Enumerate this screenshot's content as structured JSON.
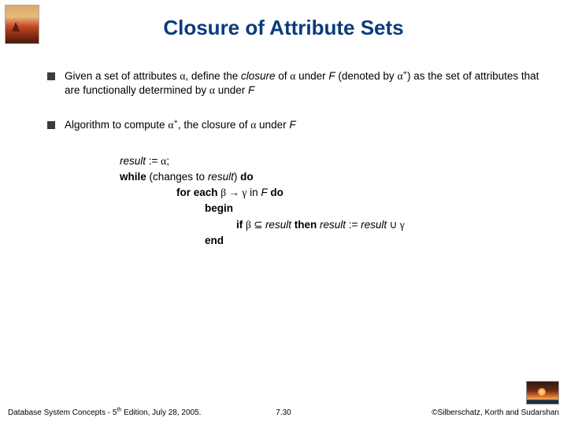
{
  "title": "Closure of Attribute Sets",
  "bullets": {
    "b1": {
      "pre": "Given a set of attributes ",
      "alpha1": "α",
      "mid1": ", define the ",
      "closure": "closure",
      "mid2": " of ",
      "alpha2": "α",
      "mid3": " under ",
      "F1": "F",
      "mid4": " (denoted by ",
      "alpha3": "α",
      "plus": "+",
      "mid5": ") as the set of attributes that are functionally determined by ",
      "alpha4": "α",
      "mid6": " under ",
      "F2": "F"
    },
    "b2": {
      "pre": " Algorithm to compute ",
      "alpha": "α",
      "plus": "+",
      "mid": ", the closure of ",
      "alpha2": "α",
      "mid2": " under ",
      "F": "F"
    }
  },
  "algo": {
    "l1_result": "result",
    "l1_assign": " := ",
    "l1_alpha": "α",
    "l1_semi": ";",
    "l2_while": "while ",
    "l2_paren": "(changes to ",
    "l2_result": "result",
    "l2_close": ") ",
    "l2_do": "do",
    "l3_for": "for each ",
    "l3_beta": "β",
    "l3_arrow": " → ",
    "l3_gamma": "γ",
    "l3_in": " in ",
    "l3_F": "F",
    "l3_do": " do",
    "l4_begin": "begin",
    "l5_if": "if ",
    "l5_beta": "β",
    "l5_sub": " ⊆ ",
    "l5_result1": "result",
    "l5_then": " then  ",
    "l5_result2": "result",
    "l5_assign": " := ",
    "l5_result3": "result",
    "l5_union": " ∪ ",
    "l5_gamma": "γ",
    "l6_end": "end"
  },
  "footer": {
    "left_pre": "Database System Concepts - 5",
    "left_sup": "th",
    "left_post": " Edition, July 28,  2005.",
    "center": "7.30",
    "right": "©Silberschatz, Korth and Sudarshan"
  }
}
